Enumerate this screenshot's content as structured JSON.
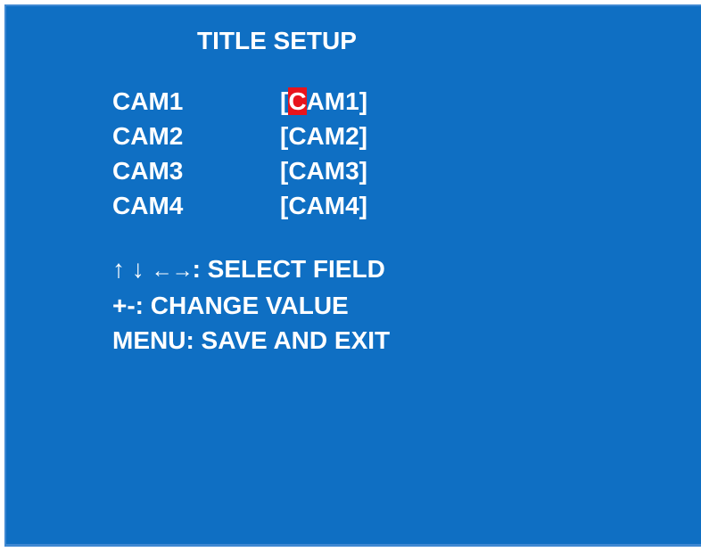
{
  "osd": {
    "title": "TITLE SETUP",
    "cameras": [
      {
        "label": "CAM1",
        "open": "[",
        "cursor_char": "C",
        "rest": "AM1",
        "close": "]"
      },
      {
        "label": "CAM2",
        "value": "[CAM2]"
      },
      {
        "label": "CAM3",
        "value": "[CAM3]"
      },
      {
        "label": "CAM4",
        "value": "[CAM4]"
      }
    ],
    "help": {
      "arrow_up": "↑",
      "arrow_down": "↓",
      "arrow_left_right": "←→",
      "select_field": ": SELECT FIELD",
      "change_value": "+-: CHANGE VALUE",
      "save_exit": "MENU: SAVE AND EXIT"
    },
    "colors": {
      "background": "#0f6fc3",
      "text": "#ffffff",
      "cursor_highlight": "#e8141c",
      "border": "#3f88d2"
    }
  }
}
